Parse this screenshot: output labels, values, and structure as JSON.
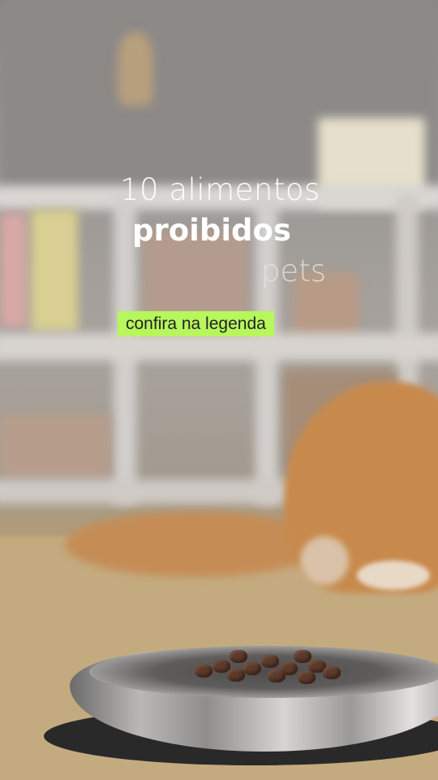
{
  "overlay": {
    "line1": "10 alimentos",
    "line2": "proibidos",
    "line3": "pets",
    "badge": "confira na legenda"
  },
  "colors": {
    "badge_bg": "#b7f65c",
    "text": "#ffffff"
  }
}
